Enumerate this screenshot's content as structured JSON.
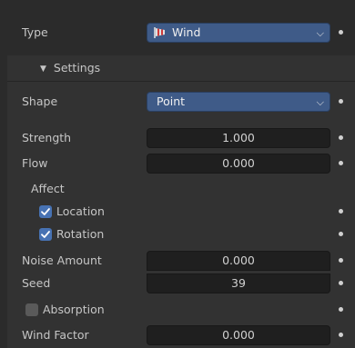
{
  "type_row": {
    "label": "Type",
    "value": "Wind",
    "icon": "wind-force-icon"
  },
  "settings": {
    "label": "Settings",
    "icon": "disclosure-triangle-down-icon"
  },
  "shape_row": {
    "label": "Shape",
    "value": "Point"
  },
  "strength": {
    "label": "Strength",
    "value": "1.000"
  },
  "flow": {
    "label": "Flow",
    "value": "0.000"
  },
  "affect": {
    "label": "Affect"
  },
  "location": {
    "label": "Location",
    "checked": true
  },
  "rotation": {
    "label": "Rotation",
    "checked": true
  },
  "noise": {
    "label": "Noise Amount",
    "value": "0.000"
  },
  "seed": {
    "label": "Seed",
    "value": "39"
  },
  "absorption": {
    "label": "Absorption",
    "checked": false
  },
  "wind_factor": {
    "label": "Wind Factor",
    "value": "0.000"
  },
  "colors": {
    "accent": "#4772b3",
    "dropdown": "#3f5b88",
    "field": "#1f1f1f",
    "panel": "#323232",
    "background": "#2b2b2b"
  }
}
